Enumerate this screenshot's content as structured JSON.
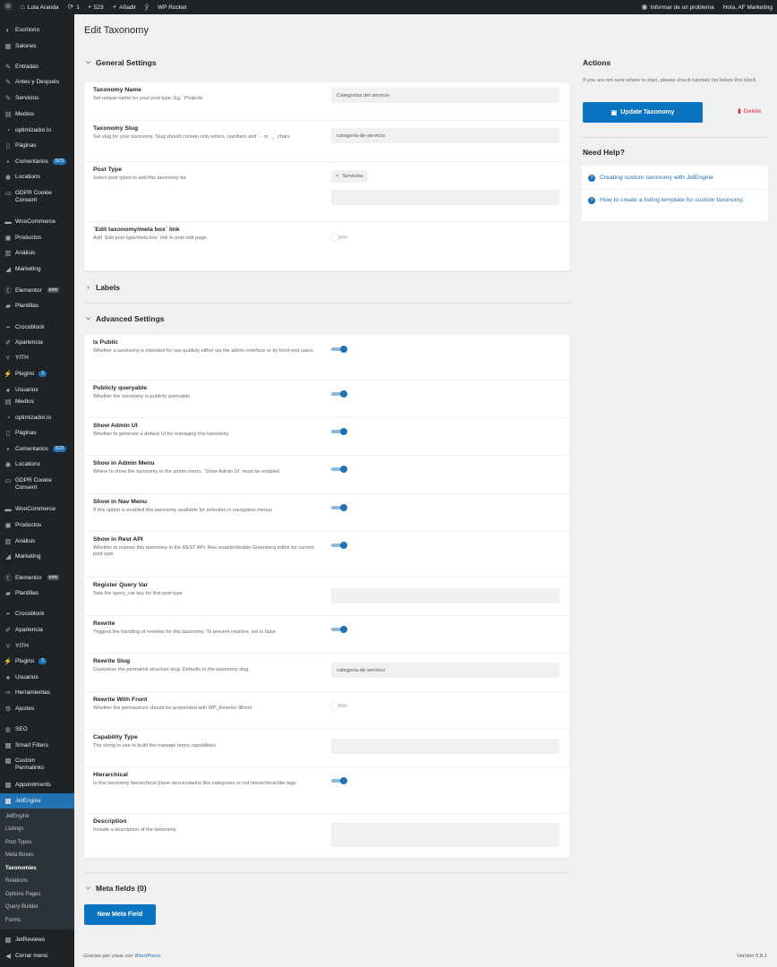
{
  "adminbar": {
    "site_name": "Lola Aranda",
    "updates_count": "1",
    "comments_count": "523",
    "add_new": "Añadir",
    "wp_rocket": "WP Rocket",
    "report_problem": "Informar de un problema",
    "greeting": "Hola, AF Marketing"
  },
  "sidebar": {
    "items": [
      {
        "label": "Escritorio",
        "icon": "dashboard-icon"
      },
      {
        "label": "Salones",
        "icon": "store-icon"
      },
      {
        "label": "Entradas",
        "icon": "pin-icon"
      },
      {
        "label": "Antes y Después",
        "icon": "pin-icon"
      },
      {
        "label": "Servicios",
        "icon": "pin-icon"
      },
      {
        "label": "Medios",
        "icon": "media-icon"
      },
      {
        "label": "optimizador.io",
        "icon": "speed-icon"
      },
      {
        "label": "Páginas",
        "icon": "page-icon"
      },
      {
        "label": "Comentarios",
        "icon": "comment-icon",
        "badge": "523"
      },
      {
        "label": "Locations",
        "icon": "location-icon"
      },
      {
        "label": "GDPR Cookie Consent",
        "icon": "cookie-icon"
      },
      {
        "label": "WooCommerce",
        "icon": "woo-icon"
      },
      {
        "label": "Productos",
        "icon": "product-icon"
      },
      {
        "label": "Análisis",
        "icon": "chart-icon"
      },
      {
        "label": "Marketing",
        "icon": "megaphone-icon"
      },
      {
        "label": "Elementor",
        "icon": "elementor-icon",
        "badge": "ERR"
      },
      {
        "label": "Plantillas",
        "icon": "folder-icon"
      },
      {
        "label": "Crocoblock",
        "icon": "crocoblock-icon"
      },
      {
        "label": "Apariencia",
        "icon": "brush-icon"
      },
      {
        "label": "YITH",
        "icon": "yith-icon"
      },
      {
        "label": "Plugins",
        "icon": "plugin-icon",
        "badge": "1"
      },
      {
        "label": "Usuarios",
        "icon": "user-icon"
      },
      {
        "label": "Medios",
        "icon": "media-icon"
      },
      {
        "label": "optimizador.io",
        "icon": "speed-icon"
      },
      {
        "label": "Páginas",
        "icon": "page-icon"
      },
      {
        "label": "Comentarios",
        "icon": "comment-icon",
        "badge": "523"
      },
      {
        "label": "Locations",
        "icon": "location-icon"
      },
      {
        "label": "GDPR Cookie Consent",
        "icon": "cookie-icon"
      },
      {
        "label": "WooCommerce",
        "icon": "woo-icon"
      },
      {
        "label": "Productos",
        "icon": "product-icon"
      },
      {
        "label": "Análisis",
        "icon": "chart-icon"
      },
      {
        "label": "Marketing",
        "icon": "megaphone-icon"
      },
      {
        "label": "Elementor",
        "icon": "elementor-icon",
        "badge": "ERR"
      },
      {
        "label": "Plantillas",
        "icon": "folder-icon"
      },
      {
        "label": "Crocoblock",
        "icon": "crocoblock-icon"
      },
      {
        "label": "Apariencia",
        "icon": "brush-icon"
      },
      {
        "label": "YITH",
        "icon": "yith-icon"
      },
      {
        "label": "Plugins",
        "icon": "plugin-icon",
        "badge": "1"
      },
      {
        "label": "Usuarios",
        "icon": "user-icon"
      },
      {
        "label": "Herramientas",
        "icon": "wrench-icon"
      },
      {
        "label": "Ajustes",
        "icon": "settings-icon"
      },
      {
        "label": "SEO",
        "icon": "seo-icon"
      },
      {
        "label": "Smart Filters",
        "icon": "jet-icon"
      },
      {
        "label": "Custom Permalinks",
        "icon": "jet-icon"
      },
      {
        "label": "Appointments",
        "icon": "jet-icon"
      },
      {
        "label": "JetEngine",
        "icon": "jet-icon",
        "active": true
      },
      {
        "label": "JetReviews",
        "icon": "jet-icon"
      },
      {
        "label": "Cerrar menú",
        "icon": "collapse-icon"
      }
    ],
    "submenu": [
      "JetEngine",
      "Listings",
      "Post Types",
      "Meta Boxes",
      "Taxonomies",
      "Relations",
      "Options Pages",
      "Query Builder",
      "Forms"
    ],
    "submenu_current": "Taxonomies"
  },
  "page": {
    "title": "Edit Taxonomy",
    "general_settings": {
      "heading": "General Settings",
      "fields": [
        {
          "label": "Taxonomy Name",
          "desc": "Set unique name for your post type. Eg. `Projects`",
          "value": "Categorías del servicio"
        },
        {
          "label": "Taxonomy Slug",
          "desc": "Set slug for your taxonomy. Slug should contain only letters, numbers and `-` or `_` chars",
          "value": "categoria-de-servicio"
        },
        {
          "label": "Post Type",
          "desc": "Select post types to add this taxonomy for",
          "tag": "Servicios"
        },
        {
          "label": "`Edit taxonomy/meta box` link",
          "desc": "Add `Edit post type/meta box` link to post edit page.",
          "toggle": false
        }
      ]
    },
    "labels_heading": "Labels",
    "advanced_settings": {
      "heading": "Advanced Settings",
      "fields": [
        {
          "label": "Is Public",
          "desc": "Whether a taxonomy is intended for use publicly either via the admin interface or by front-end users",
          "toggle": true
        },
        {
          "label": "Publicly queryable",
          "desc": "Whether the taxonomy is publicly queryable",
          "toggle": true
        },
        {
          "label": "Show Admin UI",
          "desc": "Whether to generate a default UI for managing this taxonomy",
          "toggle": true
        },
        {
          "label": "Show in Admin Menu",
          "desc": "Where to show the taxonomy in the admin menu. `Show Admin UI` must be enabled",
          "toggle": true
        },
        {
          "label": "Show in Nav Menu",
          "desc": "If this option is enabled this taxonomy available for selection in navigation menus",
          "toggle": true
        },
        {
          "label": "Show in Rest API",
          "desc": "Whether to expose this taxonomy in the REST API. Also enable/disable Gutenberg editor for current post type",
          "toggle": true
        },
        {
          "label": "Register Query Var",
          "desc": "Sets the query_var key for this post type",
          "value": ""
        },
        {
          "label": "Rewrite",
          "desc": "Triggers the handling of rewrites for this taxonomy. To prevent rewrites, set to false",
          "toggle": true
        },
        {
          "label": "Rewrite Slug",
          "desc": "Customize the permalink structure slug. Defaults to the taxonomy slug",
          "value": "categoria-de-servicio"
        },
        {
          "label": "Rewrite With Front",
          "desc": "Whether the permastruct should be prepended with WP_Rewrite::$front",
          "toggle": false
        },
        {
          "label": "Capability Type",
          "desc": "The string to use to build the manage terms capabilities",
          "value": ""
        },
        {
          "label": "Hierarchical",
          "desc": "Is this taxonomy hierarchical (have descendants) like categories or not hierarchical like tags",
          "toggle": true
        },
        {
          "label": "Description",
          "desc": "Include a description of the taxonomy",
          "value": ""
        }
      ]
    },
    "meta_fields_heading": "Meta fields (0)",
    "new_meta_field": "New Meta Field"
  },
  "aside": {
    "actions_title": "Actions",
    "actions_note": "If you are not sure where to start, please check tutorials list below this block",
    "update_button": "Update Taxonomy",
    "delete_button": "Delete",
    "help_title": "Need Help?",
    "help_links": [
      "Creating custom taxonomy with JetEngine",
      "How to create a listing template for custom taxonomy"
    ]
  },
  "footer": {
    "credit_prefix": "Gracias por crear con",
    "credit_link": "WordPress",
    "version": "Versión 5.8.1"
  },
  "colors": {
    "accent": "#2271b1",
    "button": "#0a74c1",
    "delete": "#d63638",
    "sidebar": "#1d2327"
  }
}
